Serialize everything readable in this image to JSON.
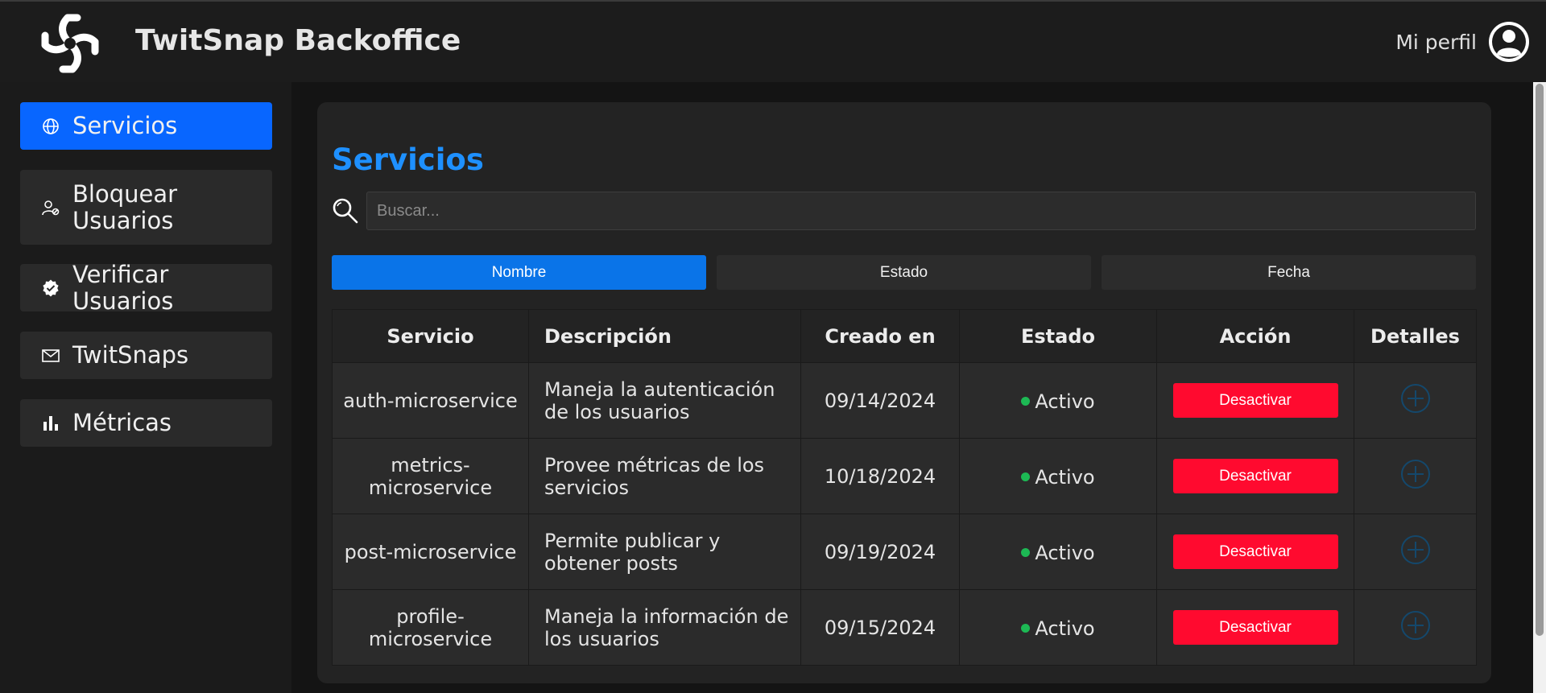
{
  "header": {
    "app_title": "TwitSnap Backoffice",
    "profile_label": "Mi perfil"
  },
  "sidebar": {
    "items": [
      {
        "label": "Servicios",
        "icon": "globe-icon",
        "active": true
      },
      {
        "label": "Bloquear Usuarios",
        "icon": "user-block-icon",
        "active": false
      },
      {
        "label": "Verificar Usuarios",
        "icon": "verified-badge-icon",
        "active": false
      },
      {
        "label": "TwitSnaps",
        "icon": "envelope-icon",
        "active": false
      },
      {
        "label": "Métricas",
        "icon": "bar-chart-icon",
        "active": false
      }
    ]
  },
  "main": {
    "title": "Servicios",
    "search": {
      "placeholder": "Buscar...",
      "value": ""
    },
    "sort_buttons": [
      {
        "label": "Nombre",
        "active": true
      },
      {
        "label": "Estado",
        "active": false
      },
      {
        "label": "Fecha",
        "active": false
      }
    ],
    "table": {
      "headers": [
        "Servicio",
        "Descripción",
        "Creado en",
        "Estado",
        "Acción",
        "Detalles"
      ],
      "rows": [
        {
          "service": "auth-microservice",
          "description": "Maneja la autenticación de los usuarios",
          "created": "09/14/2024",
          "status": "Activo",
          "action": "Desactivar"
        },
        {
          "service": "metrics-microservice",
          "description": "Provee métricas de los servicios",
          "created": "10/18/2024",
          "status": "Activo",
          "action": "Desactivar"
        },
        {
          "service": "post-microservice",
          "description": "Permite publicar y obtener posts",
          "created": "09/19/2024",
          "status": "Activo",
          "action": "Desactivar"
        },
        {
          "service": "profile-microservice",
          "description": "Maneja la información de los usuarios",
          "created": "09/15/2024",
          "status": "Activo",
          "action": "Desactivar"
        }
      ]
    }
  },
  "colors": {
    "accent": "#1e90ff",
    "active_nav": "#0866ff",
    "danger": "#ff0a2f",
    "status_active": "#1db954"
  }
}
